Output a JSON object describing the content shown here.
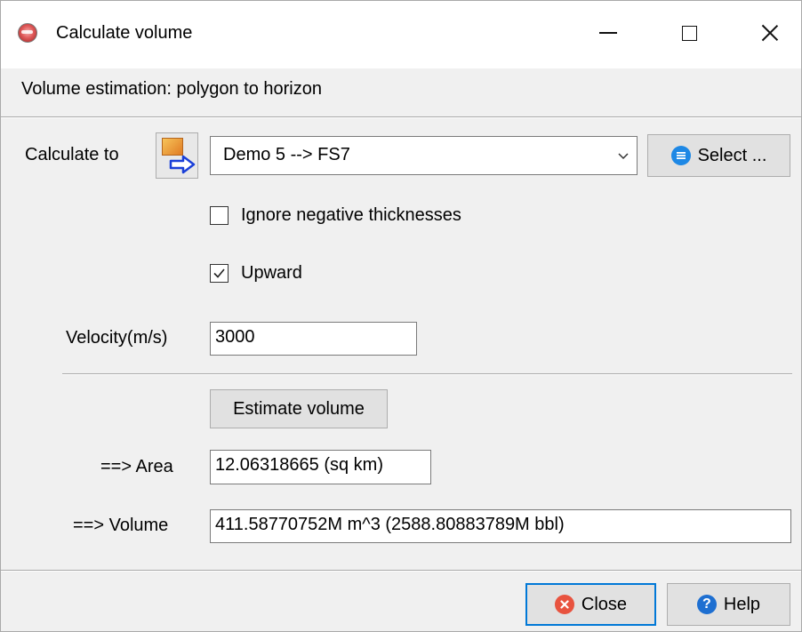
{
  "window": {
    "title": "Calculate volume",
    "app_icon": "app-logo-icon",
    "controls": [
      "minimize",
      "maximize",
      "close"
    ]
  },
  "header": {
    "description": "Volume estimation: polygon to horizon"
  },
  "calculate_to": {
    "label": "Calculate to",
    "icon": "export-arrow-icon",
    "selected": "Demo 5 --> FS7",
    "select_button": "Select ..."
  },
  "options": {
    "ignore_negative": {
      "label": "Ignore negative thicknesses",
      "checked": false
    },
    "upward": {
      "label": "Upward",
      "checked": true
    }
  },
  "velocity": {
    "label": "Velocity(m/s)",
    "value": "3000"
  },
  "estimate_button": "Estimate volume",
  "results": {
    "area_label": "==> Area",
    "area_value": "12.06318665 (sq km)",
    "volume_label": "==> Volume",
    "volume_value": "411.58770752M m^3 (2588.80883789M bbl)"
  },
  "footer": {
    "close_button": "Close",
    "help_button": "Help"
  },
  "colors": {
    "title_bg": "#ffffff",
    "dialog_bg": "#f0f0f0",
    "focus_border": "#0078d7",
    "close_icon": "#e8533f",
    "help_icon": "#1e6fd1",
    "select_icon": "#1e88e5"
  }
}
